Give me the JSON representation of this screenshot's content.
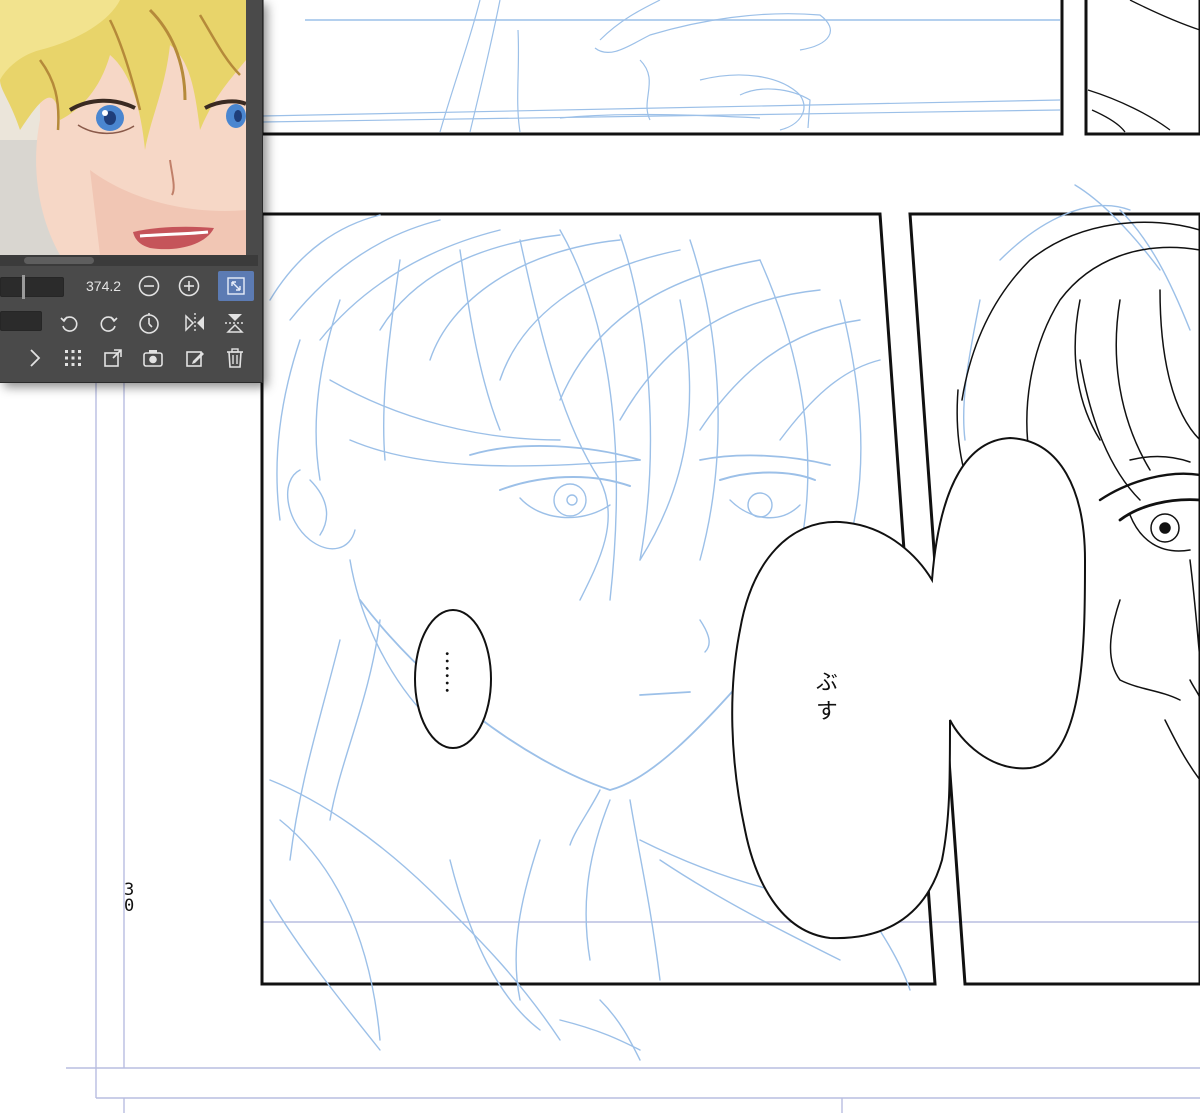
{
  "navigator": {
    "zoom_value": "374.2",
    "toolbar_row1": [
      "zoom-out-icon",
      "zoom-in-icon",
      "fit-to-view-icon"
    ],
    "toolbar_row2": [
      "rotate-left-icon",
      "rotate-right-icon",
      "reset-rotation-icon",
      "flip-horizontal-icon",
      "flip-vertical-icon"
    ],
    "toolbar_row3": [
      "chevron-right-icon",
      "grid-icon",
      "new-window-icon",
      "camera-icon",
      "edit-icon",
      "trash-icon"
    ]
  },
  "canvas": {
    "page_number": "30",
    "balloon_left_text": "……",
    "balloon_right_text": "ぶ す"
  },
  "colors": {
    "panel_bg": "#4a4a4a",
    "active_button": "#5c7bb3",
    "sketch_blue": "#9cc0e8",
    "guide_lavender": "#b8bde0"
  }
}
